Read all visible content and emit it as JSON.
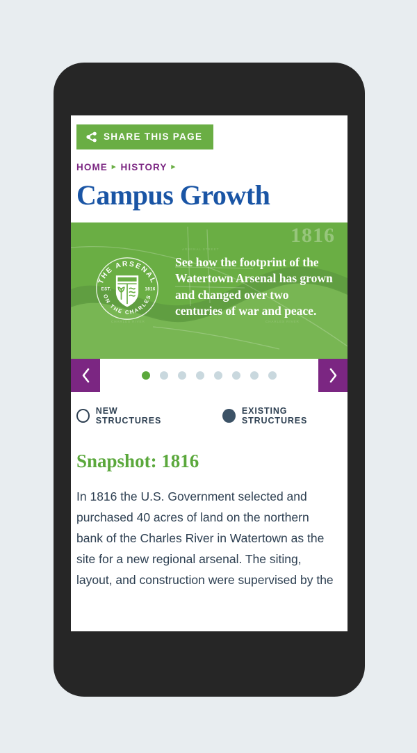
{
  "background_color": "#e8edf0",
  "device": {
    "frame_color": "#262626",
    "screen_background": "#ffffff"
  },
  "colors": {
    "green": "#6aae44",
    "green_bright": "#5ba83c",
    "purple": "#7b2682",
    "blue": "#1a55a5",
    "slate": "#2e4052",
    "slate_fill": "#3c5266",
    "dot_inactive": "#c9d8de"
  },
  "toolbar": {
    "share_label": "SHARE THIS PAGE",
    "share_icon": "share-icon"
  },
  "breadcrumb": {
    "items": [
      {
        "label": "HOME"
      },
      {
        "label": "HISTORY"
      }
    ],
    "separator": "▸",
    "trailing_separator": "▸"
  },
  "page": {
    "title": "Campus Growth"
  },
  "hero": {
    "year_watermark": "1816",
    "caption": "See how the footprint of the Watertown Arsenal has grown and changed over two centuries of war and peace.",
    "logo": {
      "top_arc_text": "THE ARSENAL",
      "bottom_arc_text": "ON THE CHARLES",
      "left_text": "EST.",
      "right_text": "1816"
    },
    "map_labels": [
      "CHARLES RIVER",
      "ARSENAL STREET"
    ]
  },
  "carousel": {
    "prev_label": "‹",
    "next_label": "›",
    "prev_icon": "chevron-left-icon",
    "next_icon": "chevron-right-icon",
    "total_slides": 8,
    "active_slide": 1
  },
  "legend": {
    "items": [
      {
        "label": "NEW STRUCTURES",
        "state": "hollow"
      },
      {
        "label": "EXISTING STRUCTURES",
        "state": "filled"
      }
    ]
  },
  "snapshot": {
    "heading": "Snapshot: 1816",
    "body": "In 1816 the U.S. Government selected and purchased 40 acres of land on the northern bank of the Charles River in Watertown as the site for a new regional arsenal. The siting, layout, and construction were supervised by the"
  }
}
